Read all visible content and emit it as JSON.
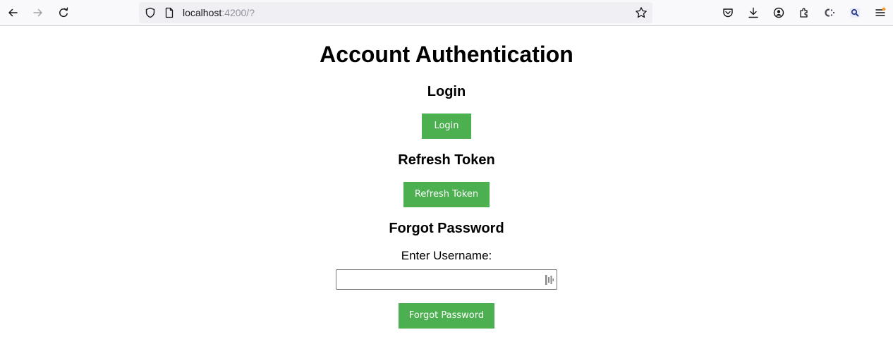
{
  "browser": {
    "url_host": "localhost",
    "url_rest": ":4200/?",
    "icons": {
      "back": "back-arrow-icon",
      "forward": "forward-arrow-icon",
      "reload": "reload-icon",
      "shield": "shield-icon",
      "page": "page-icon",
      "bookmark": "star-icon",
      "pocket": "pocket-icon",
      "downloads": "download-icon",
      "account": "account-icon",
      "extensions": "puzzle-icon",
      "ext1": "extension-c-icon",
      "ext2": "extension-search-icon",
      "menu": "hamburger-menu-icon"
    }
  },
  "page": {
    "title": "Account Authentication",
    "login": {
      "heading": "Login",
      "button_label": "Login"
    },
    "refresh": {
      "heading": "Refresh Token",
      "button_label": "Refresh Token"
    },
    "forgot": {
      "heading": "Forgot Password",
      "username_label": "Enter Username:",
      "username_value": "",
      "button_label": "Forgot Password"
    }
  },
  "colors": {
    "button_bg": "#4caf50",
    "button_text": "#ffffff",
    "toolbar_bg": "#f9f9fb",
    "urlbar_bg": "#f0f0f4",
    "notification_dot": "#f0a030"
  }
}
